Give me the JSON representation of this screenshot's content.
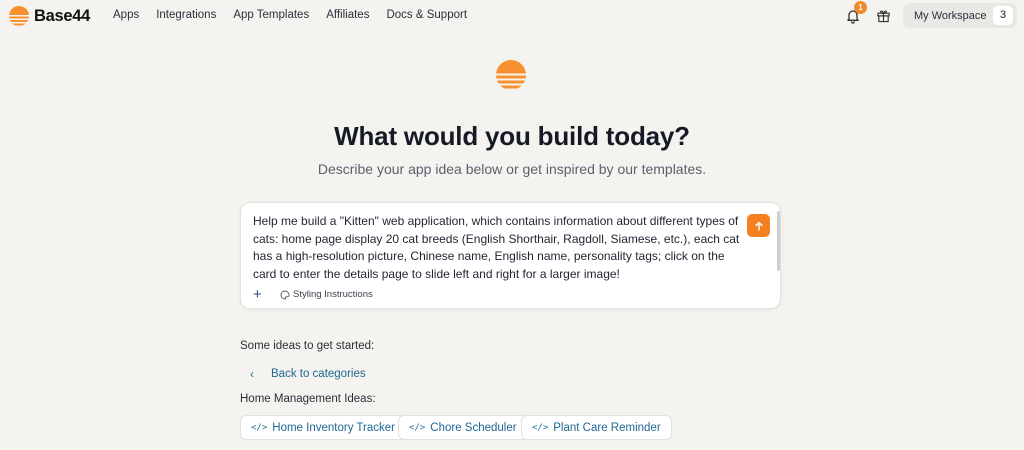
{
  "brand": {
    "name": "Base44"
  },
  "nav": [
    "Apps",
    "Integrations",
    "App Templates",
    "Affiliates",
    "Docs & Support"
  ],
  "header": {
    "notification_count": "1",
    "workspace_label": "My Workspace",
    "workspace_count": "3"
  },
  "hero": {
    "title": "What would you build today?",
    "subtitle": "Describe your app idea below or get inspired by our templates."
  },
  "prompt": {
    "value": "Help me build a \"Kitten\" web application, which contains information about different types of cats: home page display 20 cat breeds (English Shorthair, Ragdoll, Siamese, etc.), each cat has a high-resolution picture, Chinese name, English name, personality tags; click on the card to enter the details page to slide left and right for a larger image!",
    "add_label": "+",
    "styling_label": "Styling Instructions"
  },
  "ideas": {
    "heading": "Some ideas to get started:",
    "back_label": "Back to categories",
    "category_heading": "Home Management Ideas:",
    "chips": [
      "Home Inventory Tracker",
      "Chore Scheduler",
      "Plant Care Reminder"
    ]
  },
  "colors": {
    "accent": "#f4801f",
    "link": "#1f6792",
    "background": "#f4f3ef"
  },
  "icons": [
    "sunset-logo-icon",
    "bell-icon",
    "gift-icon",
    "arrow-up-icon",
    "plus-icon",
    "palette-icon",
    "chevron-left-icon",
    "code-icon"
  ]
}
